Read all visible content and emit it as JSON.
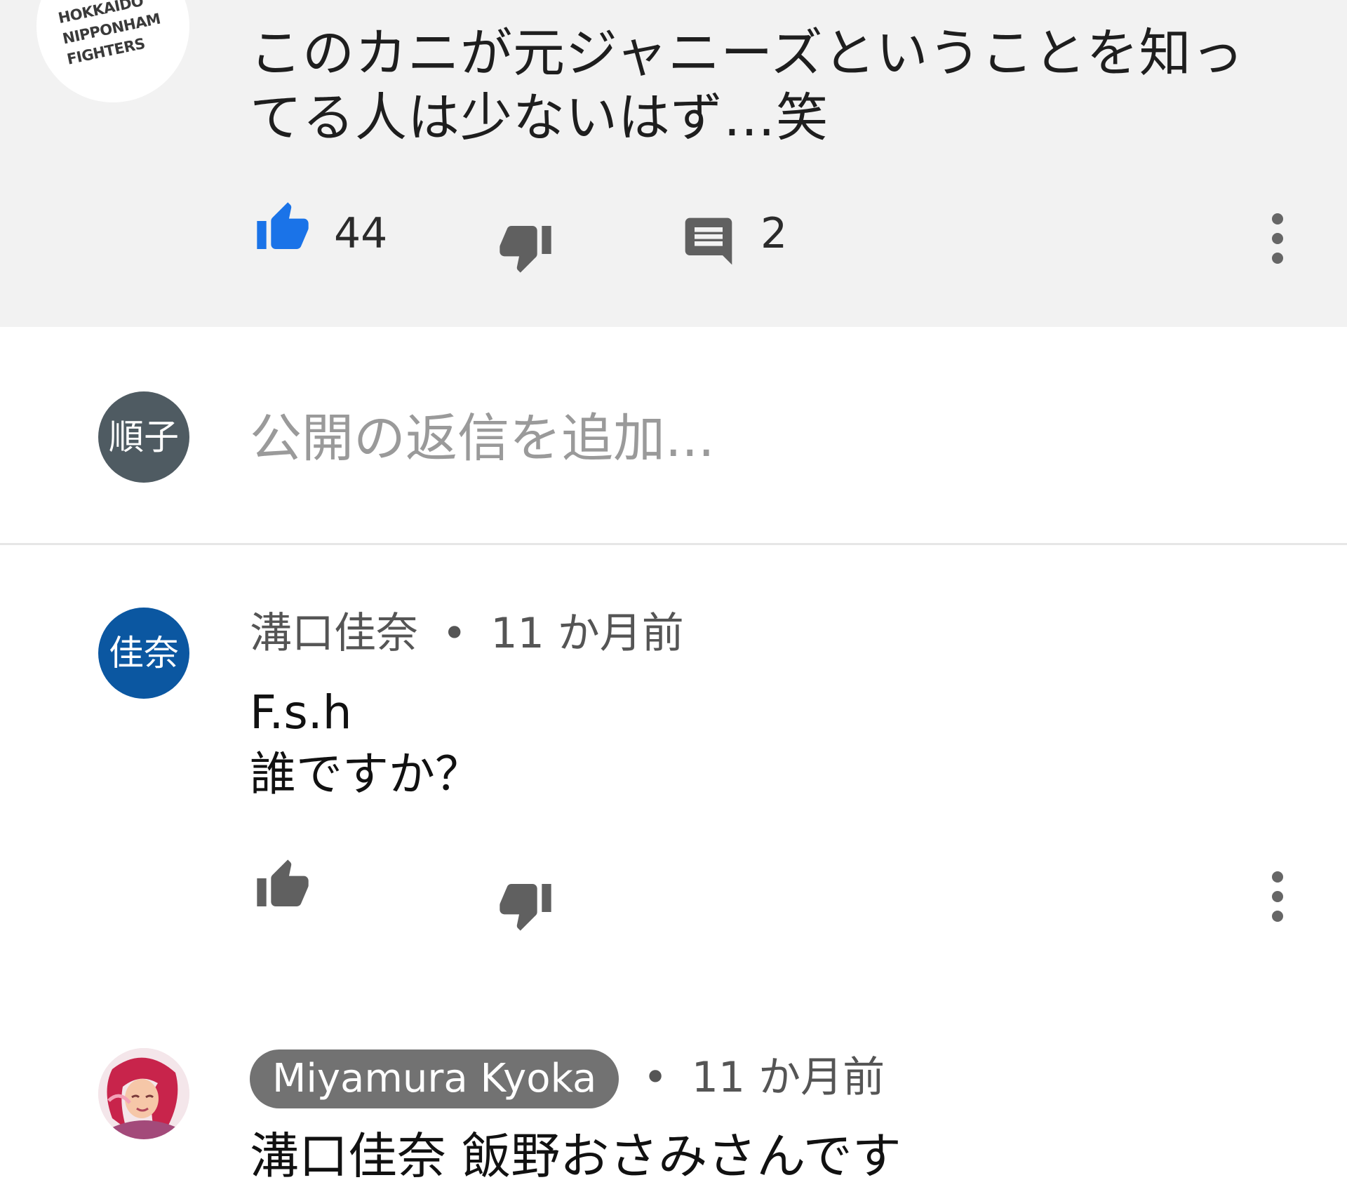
{
  "top_comment": {
    "avatar": {
      "logo_lines": [
        "HOKKAIDO",
        "NIPPONHAM",
        "FIGHTERS"
      ]
    },
    "text": "このカニが元ジャニーズということを知っ\nてる人は少ないはず…笑",
    "likes": "44",
    "replies": "2",
    "like_icon": "thumbs-up-icon",
    "dislike_icon": "thumbs-down-icon",
    "reply_icon": "comment-icon",
    "more_icon": "more-vert-icon",
    "like_color": "#1a73e8"
  },
  "reply_box": {
    "avatar_label": "順子",
    "placeholder": "公開の返信を追加..."
  },
  "replies": [
    {
      "avatar_label": "佳奈",
      "author": "溝口佳奈",
      "time": "11 か月前",
      "text": "F.s.h\n誰ですか？"
    },
    {
      "author": "Miyamura Kyoka",
      "time": "11 か月前",
      "text": "溝口佳奈 飯野おさみさんです"
    }
  ],
  "separator": "•"
}
